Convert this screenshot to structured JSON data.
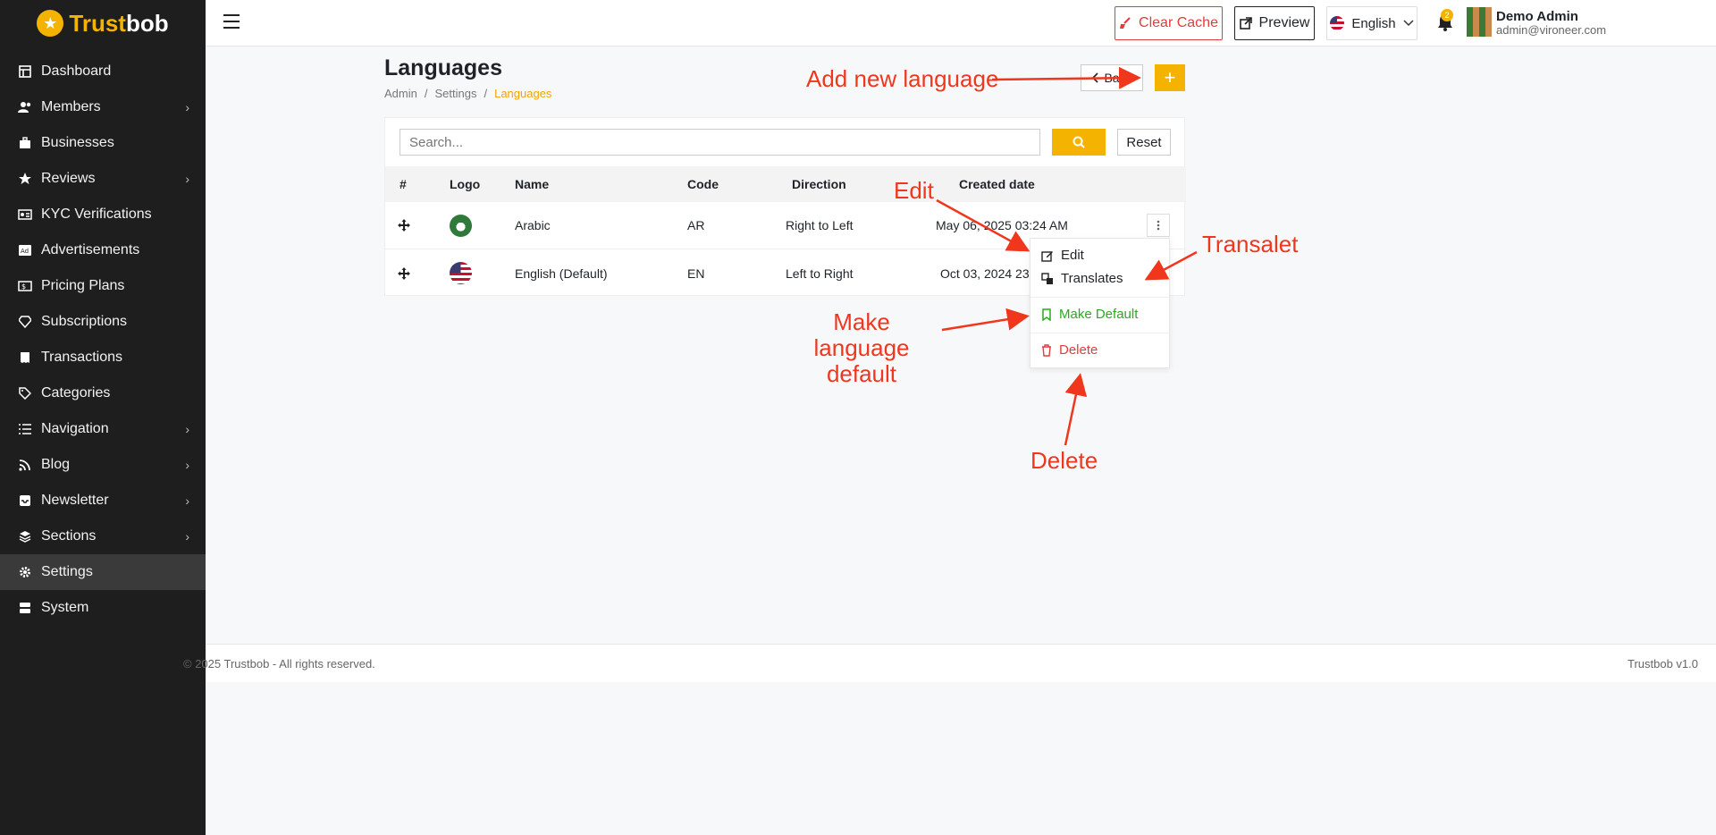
{
  "brand": {
    "part1": "Trust",
    "part2": "bob"
  },
  "sidebar": {
    "items": [
      {
        "label": "Dashboard",
        "icon": "dashboard-icon",
        "has_children": false
      },
      {
        "label": "Members",
        "icon": "users-icon",
        "has_children": true
      },
      {
        "label": "Businesses",
        "icon": "briefcase-icon",
        "has_children": false
      },
      {
        "label": "Reviews",
        "icon": "star-icon",
        "has_children": true
      },
      {
        "label": "KYC Verifications",
        "icon": "id-card-icon",
        "has_children": false
      },
      {
        "label": "Advertisements",
        "icon": "ad-icon",
        "has_children": false
      },
      {
        "label": "Pricing Plans",
        "icon": "money-icon",
        "has_children": false
      },
      {
        "label": "Subscriptions",
        "icon": "gem-icon",
        "has_children": false
      },
      {
        "label": "Transactions",
        "icon": "receipt-icon",
        "has_children": false
      },
      {
        "label": "Categories",
        "icon": "tags-icon",
        "has_children": false
      },
      {
        "label": "Navigation",
        "icon": "list-icon",
        "has_children": true
      },
      {
        "label": "Blog",
        "icon": "rss-icon",
        "has_children": true
      },
      {
        "label": "Newsletter",
        "icon": "inbox-icon",
        "has_children": true
      },
      {
        "label": "Sections",
        "icon": "layers-icon",
        "has_children": true
      },
      {
        "label": "Settings",
        "icon": "gear-icon",
        "has_children": false,
        "active": true
      },
      {
        "label": "System",
        "icon": "server-icon",
        "has_children": false
      }
    ]
  },
  "topbar": {
    "clear_cache": "Clear Cache",
    "preview": "Preview",
    "language": "English",
    "notification_count": "2",
    "user_name": "Demo Admin",
    "user_email": "admin@vironeer.com"
  },
  "page": {
    "title": "Languages",
    "breadcrumb": [
      "Admin",
      "Settings",
      "Languages"
    ],
    "back_label": "Back",
    "add_label": "+"
  },
  "search": {
    "placeholder": "Search...",
    "reset": "Reset"
  },
  "table": {
    "headers": [
      "#",
      "Logo",
      "Name",
      "Code",
      "Direction",
      "Created date"
    ],
    "rows": [
      {
        "name": "Arabic",
        "code": "AR",
        "direction": "Right to Left",
        "created": "May 06, 2025 03:24 AM",
        "flag": "flag-sa-icon"
      },
      {
        "name": "English (Default)",
        "code": "EN",
        "direction": "Left to Right",
        "created": "Oct 03, 2024 23:51",
        "flag": "flag-us-icon"
      }
    ]
  },
  "dropdown": {
    "edit": "Edit",
    "translates": "Translates",
    "make_default": "Make Default",
    "delete": "Delete"
  },
  "annotations": {
    "add_new": "Add new language",
    "edit": "Edit",
    "translate": "Transalet",
    "make_default": "Make language default",
    "delete": "Delete"
  },
  "footer": {
    "copyright": "© 2025 Trustbob - All rights reserved.",
    "version": "Trustbob v1.0"
  },
  "colors": {
    "accent": "#f5b301",
    "danger": "#e43b3b",
    "success": "#2aaa1f",
    "annotation": "#f0371e",
    "sidebar_bg": "#1e1e1e"
  }
}
